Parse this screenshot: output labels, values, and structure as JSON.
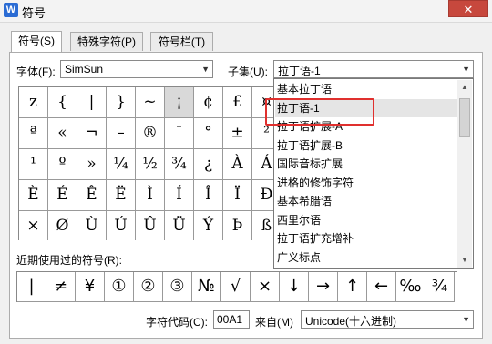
{
  "window": {
    "title": "符号",
    "app_icon": "W",
    "close_glyph": "✕"
  },
  "tabs": [
    {
      "label": "符号(S)"
    },
    {
      "label": "特殊字符(P)"
    },
    {
      "label": "符号栏(T)"
    }
  ],
  "font": {
    "label": "字体(F):",
    "value": "SimSun"
  },
  "subset": {
    "label": "子集(U):",
    "value": "拉丁语-1",
    "options": [
      "基本拉丁语",
      "拉丁语-1",
      "拉丁语扩展-A",
      "拉丁语扩展-B",
      "国际音标扩展",
      "进格的修饰字符",
      "基本希腊语",
      "西里尔语",
      "拉丁语扩充增补",
      "广义标点"
    ],
    "highlighted_index": 1
  },
  "symbol_grid": [
    [
      "z",
      "{",
      "|",
      "}",
      "~",
      "¡",
      "¢",
      "£",
      "¤"
    ],
    [
      "ª",
      "«",
      "¬",
      "–",
      "®",
      "¯",
      "°",
      "±",
      "²"
    ],
    [
      "¹",
      "º",
      "»",
      "¼",
      "½",
      "¾",
      "¿",
      "À",
      "Á"
    ],
    [
      "È",
      "É",
      "Ê",
      "Ë",
      "Ì",
      "Í",
      "Î",
      "Ï",
      "Ð"
    ],
    [
      "×",
      "Ø",
      "Ù",
      "Ú",
      "Û",
      "Ü",
      "Ý",
      "Þ",
      "ß"
    ]
  ],
  "selected_cell": {
    "row": 0,
    "col": 5
  },
  "recent": {
    "label": "近期使用过的符号(R):",
    "symbols": [
      "|",
      "≠",
      "¥",
      "①",
      "②",
      "③",
      "№",
      "√",
      "×",
      "↓",
      "→",
      "↑",
      "←",
      "‰",
      "¾"
    ]
  },
  "char_code": {
    "label": "字符代码(C):",
    "value": "00A1"
  },
  "from": {
    "label": "来自(M)",
    "value": "Unicode(十六进制)"
  },
  "icons": {
    "dropdown_arrow": "▼",
    "scroll_up": "▲",
    "scroll_down": "▼",
    "thumb_grip": "≡"
  },
  "colors": {
    "highlight_box": "#e0302e",
    "close_button": "#c7483d",
    "app_icon": "#2b6cd4"
  }
}
